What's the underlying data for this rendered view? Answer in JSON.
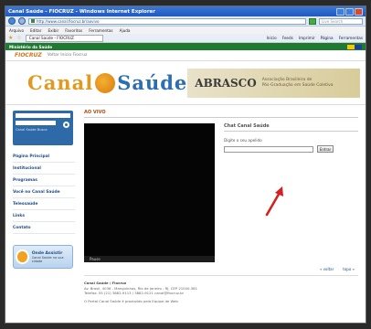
{
  "browser": {
    "title": "Canal Saúde - FIOCRUZ - Windows Internet Explorer",
    "address": "http://www.canal.fiocruz.br/aovivo",
    "search_placeholder": "Live Search",
    "menu": [
      "Arquivo",
      "Editar",
      "Exibir",
      "Favoritos",
      "Ferramentas",
      "Ajuda"
    ],
    "tab_label": "Canal Saúde - FIOCRUZ",
    "fav_right": [
      "Início",
      "Feeds",
      "Imprimir",
      "Página",
      "Ferramentas"
    ]
  },
  "gov_bar": {
    "label": "Ministério da Saúde"
  },
  "breadcrumb": {
    "logo": "FIOCRUZ",
    "tab": "Voltar Início Fiocruz"
  },
  "header": {
    "logo_left": "Canal",
    "logo_right": "Saúde",
    "banner_title": "ABRASCO",
    "banner_sub1": "Associação Brasileira de",
    "banner_sub2": "Pós-Graduação em Saúde Coletiva"
  },
  "sidebar": {
    "search_text": "Canal Saúde Busca",
    "nav": [
      "Página Principal",
      "Institucional",
      "Programas",
      "Você no Canal Saúde",
      "Telessaúde",
      "Links",
      "Contato"
    ],
    "promo_title": "Onde Assistir",
    "promo_sub": "Canal Saúde na sua cidade"
  },
  "main": {
    "live_label": "AO VIVO",
    "video_bar": "Pause",
    "chat_title": "Chat Canal Saúde",
    "chat_label": "Digite o seu apelido",
    "chat_button": "Entrar",
    "footer_nav": [
      "« voltar",
      "topo »"
    ],
    "footer_title": "Canal Saúde / Fiocruz",
    "footer_line1": "Av. Brasil, 4036 - Manguinhos, Rio de Janeiro - RJ, CEP 21040-361",
    "footer_line2": "Telefax: 55 (21) 3882-9113 / 3882-9121 canal@fiocruz.br",
    "footer_line3": "O Portal Canal Saúde é produzido pela Equipe de Web"
  }
}
